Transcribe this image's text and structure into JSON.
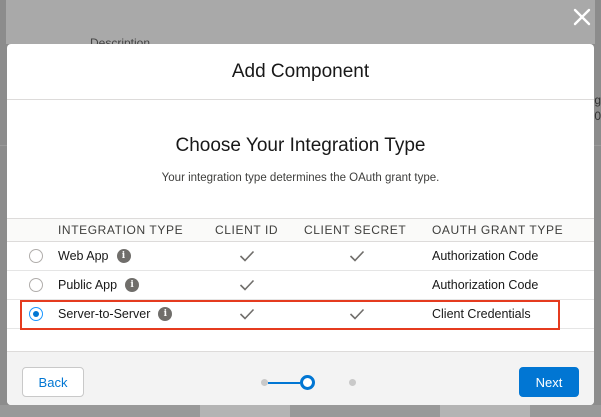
{
  "background": {
    "description_label": "Description",
    "right_fragment_1": "g",
    "right_fragment_2": "0"
  },
  "modal": {
    "title": "Add Component",
    "heading": "Choose Your Integration Type",
    "subheading": "Your integration type determines the OAuth grant type.",
    "table": {
      "headers": [
        "INTEGRATION TYPE",
        "CLIENT ID",
        "CLIENT SECRET",
        "OAUTH GRANT TYPE"
      ],
      "rows": [
        {
          "type": "Web App",
          "client_id": true,
          "client_secret": true,
          "oauth": "Authorization Code",
          "selected": false
        },
        {
          "type": "Public App",
          "client_id": true,
          "client_secret": false,
          "oauth": "Authorization Code",
          "selected": false
        },
        {
          "type": "Server-to-Server",
          "client_id": true,
          "client_secret": true,
          "oauth": "Client Credentials",
          "selected": true
        }
      ],
      "info_glyph": "i"
    },
    "footer": {
      "back_label": "Back",
      "next_label": "Next",
      "step_total": 3,
      "step_current": 2
    }
  },
  "icons": {
    "close": "close-icon",
    "info": "info-icon",
    "check": "checkmark-icon"
  },
  "colors": {
    "brand": "#0176d3",
    "highlight": "#e53b1f",
    "check": "#706e6b"
  }
}
